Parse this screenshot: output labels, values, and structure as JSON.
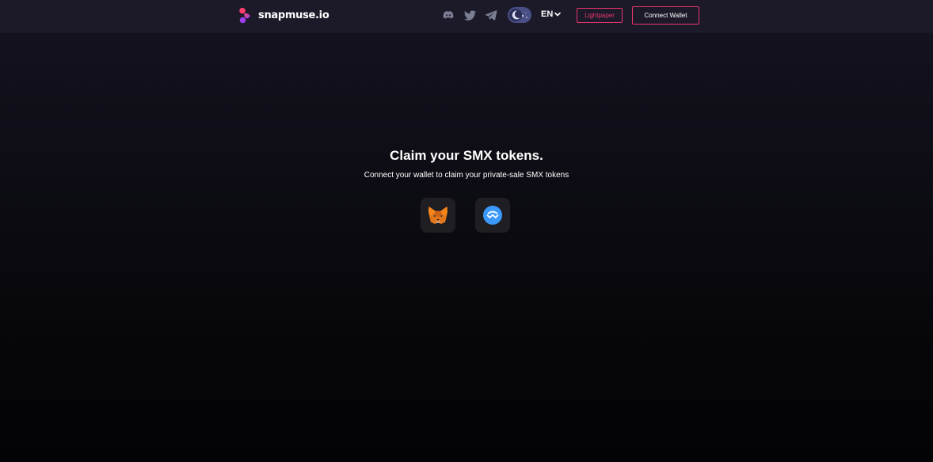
{
  "header": {
    "brand": "snapmuse.io",
    "language": "EN",
    "lightpaper_label": "Lightpaper",
    "connect_wallet_label": "Connect Wallet",
    "social_icons": [
      "discord-icon",
      "twitter-icon",
      "telegram-icon"
    ],
    "theme_toggle_icon": "moon-icon"
  },
  "main": {
    "title": "Claim your SMX tokens.",
    "subtitle": "Connect your wallet to claim your private-sale SMX tokens",
    "wallet_icons": [
      "metamask-icon",
      "walletconnect-icon"
    ]
  },
  "colors": {
    "accent": "#e8366d",
    "header_bg": "#1c1a29",
    "wallet_button_bg": "#1e1e23",
    "walletconnect_blue": "#3b99fc",
    "metamask_orange": "#f6851b"
  }
}
